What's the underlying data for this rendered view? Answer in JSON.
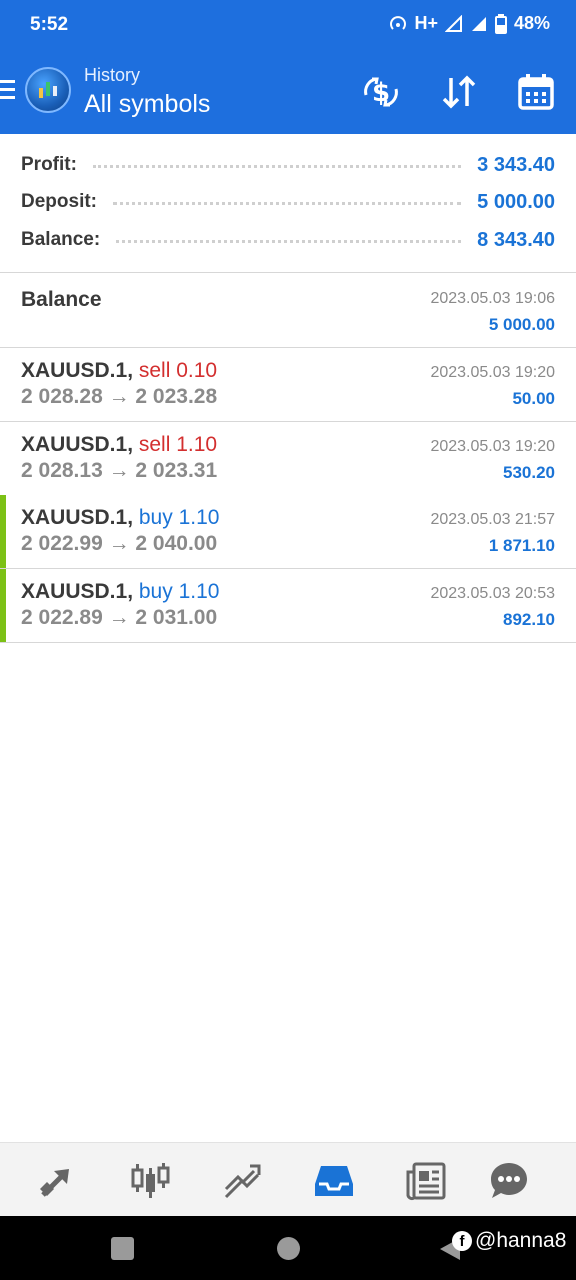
{
  "status_bar": {
    "time": "5:52",
    "network": "H+",
    "battery": "48%"
  },
  "app_bar": {
    "subtitle": "History",
    "title": "All symbols",
    "actions": [
      "currency-exchange-icon",
      "sort-icon",
      "calendar-icon"
    ]
  },
  "summary": {
    "profit_label": "Profit:",
    "profit_value": "3 343.40",
    "deposit_label": "Deposit:",
    "deposit_value": "5 000.00",
    "balance_label": "Balance:",
    "balance_value": "8 343.40"
  },
  "deals": [
    {
      "title": "Balance",
      "time": "2023.05.03 19:06",
      "amount": "5 000.00"
    },
    {
      "symbol": "XAUUSD.1,",
      "action": "sell 0.10",
      "side": "sell",
      "prices": "2 028.28 → 2 023.28",
      "time": "2023.05.03 19:20",
      "profit": "50.00"
    },
    {
      "symbol": "XAUUSD.1,",
      "action": "sell 1.10",
      "side": "sell",
      "prices": "2 028.13 → 2 023.31",
      "time": "2023.05.03 19:20",
      "profit": "530.20"
    },
    {
      "symbol": "XAUUSD.1,",
      "action": "buy 1.10",
      "side": "buy",
      "prices": "2 022.99 → 2 040.00",
      "time": "2023.05.03 21:57",
      "profit": "1 871.10"
    },
    {
      "symbol": "XAUUSD.1,",
      "action": "buy 1.10",
      "side": "buy",
      "prices": "2 022.89 → 2 031.00",
      "time": "2023.05.03 20:53",
      "profit": "892.10"
    }
  ],
  "bottom_nav": {
    "items": [
      "quotes-icon",
      "chart-icon",
      "trade-icon",
      "history-icon",
      "news-icon",
      "chat-icon"
    ],
    "active": "history-icon"
  },
  "watermark": "@hanna8",
  "colors": {
    "primary": "#1e6fde",
    "profit": "#1a73d6",
    "sell": "#d32f2f",
    "buy": "#1a73d6",
    "accent_bar": "#7cc116"
  }
}
